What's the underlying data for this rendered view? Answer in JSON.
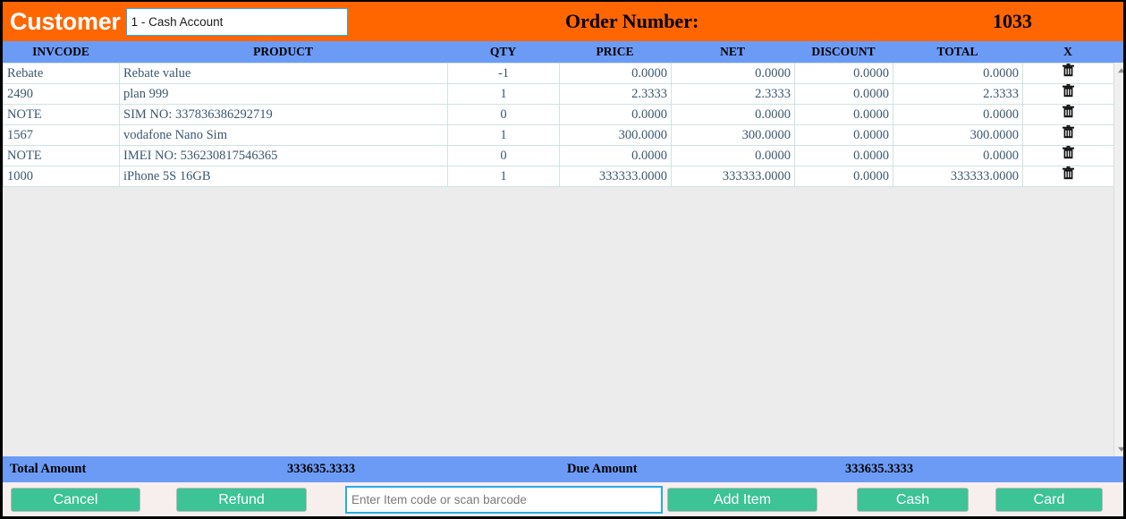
{
  "header": {
    "customer_label": "Customer",
    "customer_value": "1 - Cash Account",
    "order_label": "Order Number:",
    "order_number": "1033",
    "accent_orange": "#FF6600",
    "accent_blue": "#6C9BF5",
    "accent_green": "#3CC396",
    "accent_cyan": "#29ABE2"
  },
  "table": {
    "columns": [
      {
        "key": "invcode",
        "label": "INVCODE"
      },
      {
        "key": "product",
        "label": "PRODUCT"
      },
      {
        "key": "qty",
        "label": "QTY"
      },
      {
        "key": "price",
        "label": "PRICE"
      },
      {
        "key": "net",
        "label": "NET"
      },
      {
        "key": "discount",
        "label": "DISCOUNT"
      },
      {
        "key": "total",
        "label": "TOTAL"
      },
      {
        "key": "delete",
        "label": "X"
      }
    ],
    "rows": [
      {
        "invcode": "Rebate",
        "product": "Rebate value",
        "qty": "-1",
        "price": "0.0000",
        "net": "0.0000",
        "discount": "0.0000",
        "total": "0.0000",
        "delete_icon": "trash-icon"
      },
      {
        "invcode": "2490",
        "product": "plan 999",
        "qty": "1",
        "price": "2.3333",
        "net": "2.3333",
        "discount": "0.0000",
        "total": "2.3333",
        "delete_icon": "trash-icon"
      },
      {
        "invcode": "NOTE",
        "product": "SIM NO: 337836386292719",
        "qty": "0",
        "price": "0.0000",
        "net": "0.0000",
        "discount": "0.0000",
        "total": "0.0000",
        "delete_icon": "trash-icon"
      },
      {
        "invcode": "1567",
        "product": "vodafone Nano Sim",
        "qty": "1",
        "price": "300.0000",
        "net": "300.0000",
        "discount": "0.0000",
        "total": "300.0000",
        "delete_icon": "trash-icon"
      },
      {
        "invcode": "NOTE",
        "product": "IMEI NO: 536230817546365",
        "qty": "0",
        "price": "0.0000",
        "net": "0.0000",
        "discount": "0.0000",
        "total": "0.0000",
        "delete_icon": "trash-icon"
      },
      {
        "invcode": "1000",
        "product": "iPhone 5S 16GB",
        "qty": "1",
        "price": "333333.0000",
        "net": "333333.0000",
        "discount": "0.0000",
        "total": "333333.0000",
        "delete_icon": "trash-icon"
      }
    ]
  },
  "scrollbar": {
    "up_icon": "scroll-up-arrow-icon",
    "down_icon": "scroll-down-arrow-icon"
  },
  "totals": {
    "total_amount_label": "Total Amount",
    "total_amount_value": "333635.3333",
    "due_amount_label": "Due Amount",
    "due_amount_value": "333635.3333"
  },
  "actions": {
    "cancel": "Cancel",
    "refund": "Refund",
    "add_item": "Add Item",
    "cash": "Cash",
    "card": "Card",
    "barcode_placeholder": "Enter Item code or scan barcode",
    "barcode_value": ""
  }
}
